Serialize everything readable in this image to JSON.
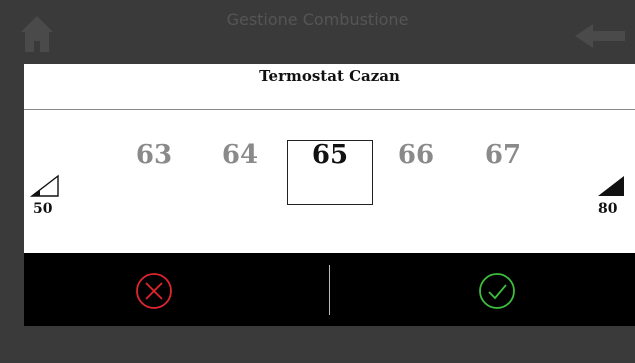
{
  "header": {
    "title": "Gestione Combustione",
    "home_icon": "home-icon",
    "back_icon": "back-arrow-icon"
  },
  "dialog": {
    "title": "Termostat Cazan",
    "values": [
      "63",
      "64",
      "65",
      "66",
      "67"
    ],
    "selected_value": "65",
    "min": "50",
    "max": "80",
    "min_icon": "signal-low-icon",
    "max_icon": "signal-high-icon"
  },
  "actions": {
    "cancel_icon": "cancel-x-icon",
    "confirm_icon": "confirm-check-icon",
    "cancel_color": "#e0252f",
    "confirm_color": "#3dbf3d"
  }
}
